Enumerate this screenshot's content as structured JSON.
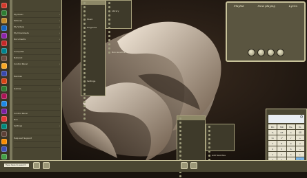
{
  "start_menu": {
    "items": [
      {
        "label": "",
        "arrow": ""
      },
      {
        "label": "My Music",
        "arrow": "›"
      },
      {
        "label": "Pictures",
        "arrow": "›"
      },
      {
        "label": "My Videos",
        "arrow": "›"
      },
      {
        "label": "My Downloads",
        "arrow": "›"
      },
      {
        "label": "Documents",
        "arrow": "›"
      },
      {
        "label": "",
        "arrow": ""
      },
      {
        "label": "Computer",
        "arrow": ""
      },
      {
        "label": "Network",
        "arrow": ""
      },
      {
        "label": "Control Panel",
        "arrow": "›"
      },
      {
        "label": "",
        "arrow": ""
      },
      {
        "label": "Devices",
        "arrow": ""
      },
      {
        "label": "",
        "arrow": ""
      },
      {
        "label": "Games",
        "arrow": "›"
      },
      {
        "label": "",
        "arrow": ""
      },
      {
        "label": "",
        "arrow": ""
      },
      {
        "label": "",
        "arrow": ""
      },
      {
        "label": "Control Panel",
        "arrow": ""
      },
      {
        "label": "Run",
        "arrow": ""
      },
      {
        "label": "Settings",
        "arrow": "›"
      },
      {
        "label": "",
        "arrow": ""
      },
      {
        "label": "Help and Support",
        "arrow": ""
      },
      {
        "label": "",
        "arrow": ""
      }
    ],
    "app_icon_colors": [
      "#d33a2c",
      "#2e7d32",
      "#c08a2a",
      "#1565c0",
      "#8e24aa",
      "#c62828",
      "#00838f",
      "#6d4c41",
      "#f9a825",
      "#3949ab",
      "#d84315",
      "#2e7d32",
      "#ad1457",
      "#1e88e5",
      "#7b1fa2",
      "#e53935",
      "#00897b",
      "#5d4037",
      "#fb8c00",
      "#3f51b5",
      "#43a047"
    ]
  },
  "submenu_1": {
    "items": [
      "",
      "",
      "",
      "",
      "Music",
      "",
      "Programs",
      "",
      "",
      "",
      "",
      "",
      "",
      "",
      "",
      "",
      "",
      "",
      "",
      "Settings",
      "",
      "",
      "",
      "",
      "",
      "",
      "",
      "",
      ""
    ]
  },
  "submenu_2": {
    "items": [
      "",
      "",
      "Library",
      "",
      "",
      "",
      "",
      "",
      "",
      "",
      "",
      "",
      "Run as admin"
    ]
  },
  "context_menu": {
    "items": [
      "",
      "",
      "",
      "",
      "",
      "",
      "",
      "",
      "",
      "",
      "",
      "",
      "",
      "",
      ""
    ]
  },
  "context_sub": {
    "items": [
      "",
      "",
      "",
      "",
      "",
      "",
      "",
      "Add favorites",
      "",
      "",
      "Edit"
    ]
  },
  "player": {
    "tabs": [
      "Playlist",
      "Now playing",
      "Lyrics"
    ],
    "tracks": [
      "",
      "",
      "",
      "",
      "",
      "",
      "",
      "",
      "",
      ""
    ]
  },
  "calculator": {
    "display": "0",
    "keys": [
      "MC",
      "MR",
      "M+",
      "M-",
      "%",
      "CE",
      "C",
      "⌫",
      "⅟x",
      "x²",
      "√",
      "÷",
      "7",
      "8",
      "9",
      "×",
      "4",
      "5",
      "6",
      "−",
      "1",
      "2",
      "3",
      "+",
      "±",
      "0",
      ".",
      "="
    ]
  },
  "taskbar": {
    "search_placeholder": "Type here to search",
    "clock_time": "",
    "clock_date": ""
  }
}
